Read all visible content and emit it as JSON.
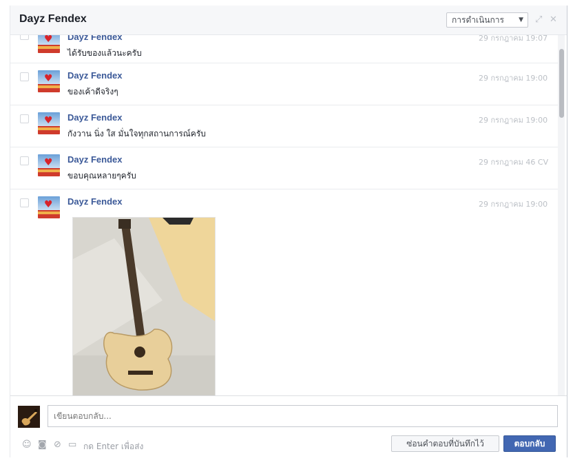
{
  "header": {
    "title": "Dayz Fendex",
    "actions_label": "การดำเนินการ",
    "caret": "▼",
    "expand_glyph": "⤢",
    "close_glyph": "✕"
  },
  "messages": [
    {
      "sender": "Dayz Fendex",
      "text": "ได้รับของแล้วนะครับ",
      "time": "29 กรกฎาคม 19:07"
    },
    {
      "sender": "Dayz Fendex",
      "text": "ของเค้าดีจริงๆ",
      "time": "29 กรกฎาคม 19:00"
    },
    {
      "sender": "Dayz Fendex",
      "text": "กังวาน นิ่ง ใส มั่นใจทุกสถานการณ์ครับ",
      "time": "29 กรกฎาคม 19:00"
    },
    {
      "sender": "Dayz Fendex",
      "text": "ขอบคุณหลายๆครับ",
      "time": "29 กรกฎาคม 46 CV"
    },
    {
      "sender": "Dayz Fendex",
      "text": "",
      "time": "29 กรกฎาคม 19:00"
    }
  ],
  "composer": {
    "placeholder": "เขียนตอบกลับ...",
    "enter_hint": "กด Enter เพื่อส่ง",
    "saved_replies_label": "ซ่อนคำตอบที่บันทึกไว้",
    "reply_label": "ตอบกลับ"
  },
  "icons": [
    "emoji-icon",
    "camera-icon",
    "attach-icon",
    "sticker-icon"
  ],
  "colors": {
    "sender": "#3b5998",
    "reply_button": "#4267b2",
    "timestamp": "#bcc0c6"
  }
}
